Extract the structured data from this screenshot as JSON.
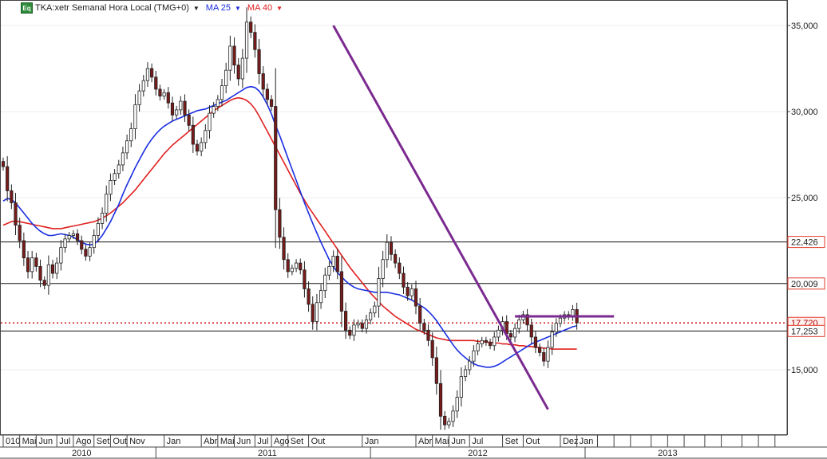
{
  "legend": {
    "symbol_badge": "Eq",
    "instrument": "TKA:xetr Semanal Hora Local (TMG+0)",
    "ma25_label": "MA 25",
    "ma40_label": "MA 40",
    "ma25_color": "#1a2ee0",
    "ma40_color": "#e02020",
    "dropdown_icon": "caret-down-icon"
  },
  "colors": {
    "candle_up_fill": "#ffffff",
    "candle_down_fill": "#7a1a1a",
    "candle_outline": "#222222",
    "trendline": "#7b2a90",
    "price_line": "#d01010",
    "level_box_border": "#e03a2a"
  },
  "chart_data": {
    "type": "candlestick",
    "y_ticks": [
      "35,000",
      "30,000",
      "25,000",
      "15,000"
    ],
    "ylim": [
      10600,
      36300
    ],
    "level_labels": [
      "22,426",
      "20,009",
      "17,720",
      "17,253"
    ],
    "month_labels": [
      {
        "week": 0,
        "label": "010"
      },
      {
        "week": 4,
        "label": "Mai"
      },
      {
        "week": 8,
        "label": "Jun"
      },
      {
        "week": 13,
        "label": "Jul"
      },
      {
        "week": 17,
        "label": "Ago"
      },
      {
        "week": 22,
        "label": "Set"
      },
      {
        "week": 26,
        "label": "Out"
      },
      {
        "week": 30,
        "label": "Nov"
      },
      {
        "week": 39,
        "label": "Jan"
      },
      {
        "week": 48,
        "label": "Abr"
      },
      {
        "week": 52,
        "label": "Mai"
      },
      {
        "week": 56,
        "label": "Jun"
      },
      {
        "week": 61,
        "label": "Jul"
      },
      {
        "week": 65,
        "label": "Ago"
      },
      {
        "week": 69,
        "label": "Set"
      },
      {
        "week": 74,
        "label": "Out"
      },
      {
        "week": 87,
        "label": "Jan"
      },
      {
        "week": 100,
        "label": "Abr"
      },
      {
        "week": 104,
        "label": "Mai"
      },
      {
        "week": 108,
        "label": "Jun"
      },
      {
        "week": 113,
        "label": "Jul"
      },
      {
        "week": 121,
        "label": "Set"
      },
      {
        "week": 126,
        "label": "Out"
      },
      {
        "week": 135,
        "label": "Dez"
      },
      {
        "week": 139,
        "label": "Jan"
      }
    ],
    "year_labels": [
      {
        "week": 19,
        "label": "2010"
      },
      {
        "week": 64,
        "label": "2011"
      },
      {
        "week": 115,
        "label": "2012"
      },
      {
        "week": 161,
        "label": "2013"
      }
    ],
    "year_dividers": [
      37,
      89,
      141
    ],
    "closes": [
      26800,
      25400,
      24700,
      23400,
      22500,
      21500,
      20700,
      21500,
      21000,
      20200,
      19900,
      21100,
      20600,
      21200,
      22100,
      22600,
      22800,
      22900,
      22500,
      22000,
      21600,
      22100,
      22800,
      23500,
      24100,
      25200,
      26000,
      26400,
      26900,
      27600,
      28300,
      29000,
      30400,
      31200,
      31800,
      32500,
      32000,
      31300,
      30900,
      31100,
      30500,
      29800,
      30100,
      30600,
      29800,
      29200,
      28100,
      27700,
      28200,
      28900,
      29900,
      30300,
      30700,
      31500,
      32400,
      33800,
      32700,
      31900,
      33100,
      35200,
      34600,
      33600,
      32200,
      31300,
      30700,
      30300,
      24300,
      22700,
      21400,
      20700,
      20900,
      21200,
      20800,
      19700,
      18800,
      17800,
      18900,
      19600,
      20500,
      21000,
      21600,
      20700,
      18400,
      17300,
      17000,
      17600,
      17700,
      17400,
      17900,
      18300,
      18700,
      20300,
      21400,
      22400,
      21700,
      21200,
      20600,
      19800,
      19300,
      19700,
      18700,
      17700,
      17300,
      16700,
      15700,
      14200,
      12300,
      11800,
      12000,
      12600,
      13400,
      14600,
      15000,
      15500,
      16100,
      16500,
      16700,
      16600,
      16400,
      16900,
      17300,
      17800,
      17100,
      16900,
      17400,
      17900,
      18200,
      17600,
      16900,
      16300,
      16000,
      15500,
      16300,
      17200,
      17700,
      18000,
      18200,
      18100,
      18500,
      17720
    ],
    "ma25": [
      24800,
      24950,
      24900,
      24700,
      24400,
      24100,
      23800,
      23500,
      23250,
      23050,
      22900,
      22800,
      22800,
      22850,
      22900,
      22850,
      22800,
      22700,
      22550,
      22400,
      22300,
      22250,
      22300,
      22500,
      22800,
      23200,
      23600,
      24100,
      24600,
      25200,
      25750,
      26250,
      26750,
      27200,
      27650,
      28050,
      28400,
      28700,
      28950,
      29150,
      29300,
      29450,
      29550,
      29650,
      29750,
      29850,
      29950,
      30050,
      30100,
      30150,
      30250,
      30350,
      30450,
      30550,
      30650,
      30800,
      30950,
      31100,
      31250,
      31400,
      31450,
      31400,
      31200,
      30850,
      30400,
      29850,
      29200,
      28600,
      27950,
      27300,
      26650,
      26000,
      25350,
      24700,
      24100,
      23500,
      22950,
      22400,
      21900,
      21400,
      21000,
      20650,
      20400,
      20150,
      19950,
      19800,
      19700,
      19650,
      19600,
      19550,
      19500,
      19500,
      19500,
      19500,
      19450,
      19400,
      19350,
      19250,
      19150,
      19050,
      18900,
      18750,
      18600,
      18400,
      18150,
      17850,
      17500,
      17150,
      16800,
      16450,
      16150,
      15900,
      15700,
      15500,
      15350,
      15250,
      15200,
      15150,
      15150,
      15200,
      15300,
      15450,
      15600,
      15750,
      15900,
      16050,
      16200,
      16350,
      16500,
      16600,
      16700,
      16800,
      16900,
      17000,
      17100,
      17200,
      17300,
      17400,
      17500,
      17550
    ],
    "ma40": [
      23400,
      23500,
      23600,
      23650,
      23600,
      23550,
      23500,
      23450,
      23400,
      23350,
      23300,
      23250,
      23200,
      23200,
      23200,
      23250,
      23300,
      23350,
      23400,
      23450,
      23500,
      23550,
      23600,
      23700,
      23800,
      23950,
      24100,
      24300,
      24500,
      24700,
      24950,
      25200,
      25450,
      25750,
      26050,
      26350,
      26650,
      26950,
      27250,
      27550,
      27800,
      28050,
      28250,
      28450,
      28650,
      28850,
      29050,
      29250,
      29450,
      29650,
      29850,
      30050,
      30200,
      30350,
      30500,
      30650,
      30750,
      30800,
      30750,
      30650,
      30450,
      30150,
      29750,
      29300,
      28850,
      28400,
      27950,
      27500,
      27050,
      26600,
      26150,
      25700,
      25250,
      24850,
      24450,
      24100,
      23750,
      23400,
      23050,
      22700,
      22350,
      22000,
      21650,
      21300,
      20950,
      20650,
      20350,
      20050,
      19750,
      19450,
      19200,
      18950,
      18700,
      18500,
      18300,
      18100,
      17950,
      17800,
      17650,
      17500,
      17350,
      17250,
      17150,
      17050,
      16950,
      16850,
      16800,
      16750,
      16700,
      16700,
      16700,
      16700,
      16700,
      16700,
      16700,
      16650,
      16650,
      16600,
      16600,
      16550,
      16550,
      16500,
      16500,
      16450,
      16450,
      16400,
      16400,
      16350,
      16350,
      16300,
      16300,
      16250,
      16250,
      16200,
      16200,
      16200,
      16200,
      16200,
      16200,
      16200
    ],
    "horizontal_levels": [
      22426,
      20009,
      17253
    ],
    "dotted_price_line": 17720,
    "trendlines": [
      {
        "w1": 80,
        "p1": 35000,
        "w2": 132,
        "p2": 12700
      },
      {
        "w1": 124,
        "p1": 18100,
        "w2": 148,
        "p2": 18100
      }
    ]
  }
}
